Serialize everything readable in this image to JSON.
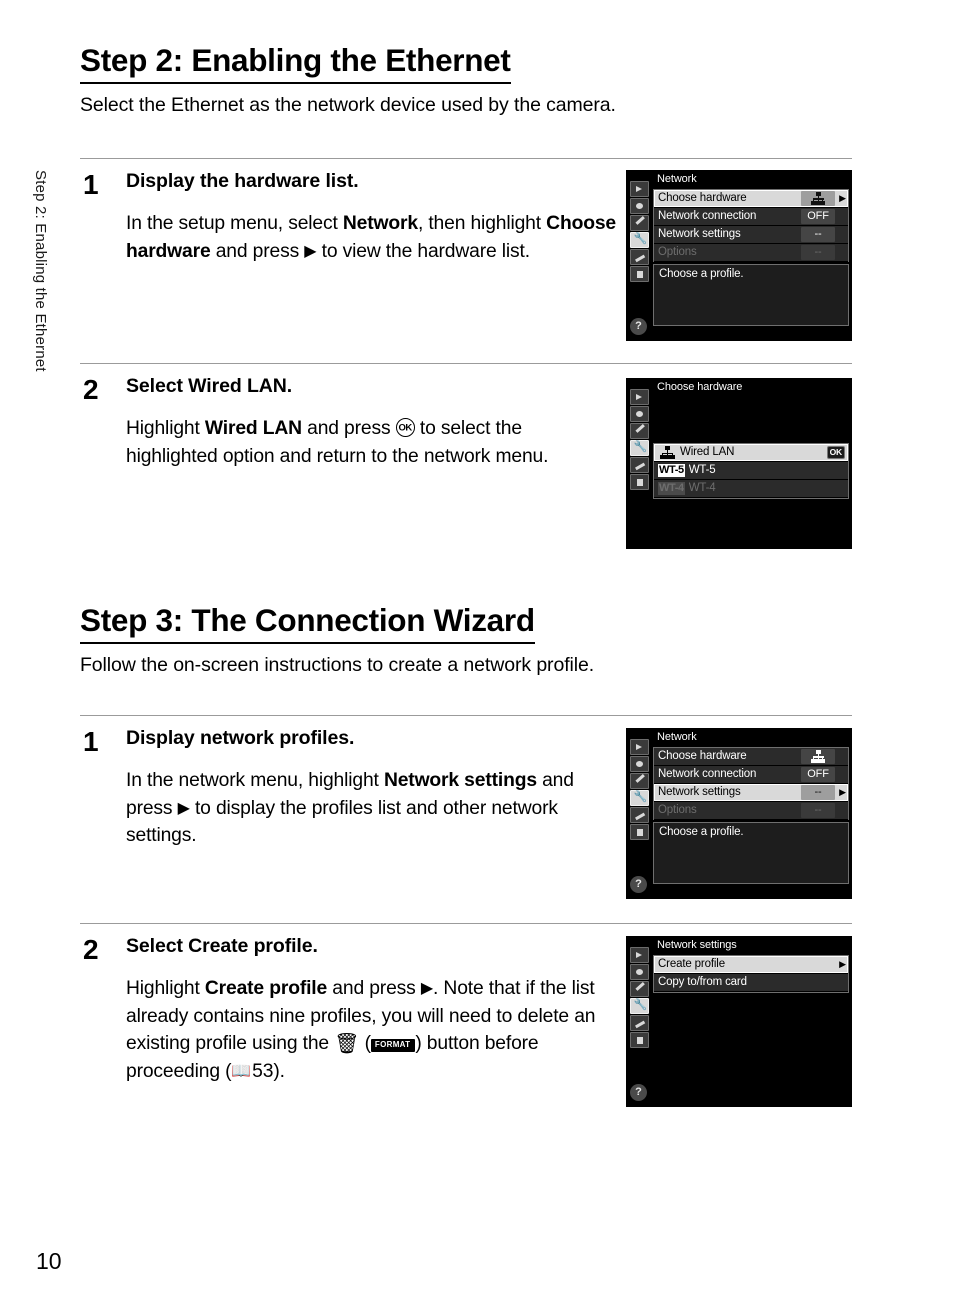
{
  "page_number": "10",
  "side_tab": "Step 2: Enabling the Ethernet",
  "sections": [
    {
      "title": "Step 2: Enabling the Ethernet",
      "subtitle": "Select the Ethernet as the network device used by the camera."
    },
    {
      "title": "Step 3: The Connection Wizard",
      "subtitle": "Follow the on-screen instructions to create a network profile."
    }
  ],
  "steps": {
    "s2_1": {
      "number": "1",
      "heading": "Display the hardware list.",
      "text_1": "In the setup menu, select ",
      "bold_1": "Network",
      "text_2": ", then highlight ",
      "bold_2": "Choose hardware",
      "text_3": " and press ",
      "glyph": "▶",
      "text_4": " to view the hardware list."
    },
    "s2_2": {
      "number": "2",
      "heading_plain": "Select ",
      "heading_bold": "Wired LAN",
      "heading_end": ".",
      "text_1": "Highlight ",
      "bold_1": "Wired LAN",
      "text_2": " and press ",
      "ok_glyph": "OK",
      "text_3": " to select the highlighted option and return to the network menu."
    },
    "s3_1": {
      "number": "1",
      "heading": "Display network profiles.",
      "text_1": "In the network menu, highlight ",
      "bold_1": "Network settings",
      "text_2": " and press ",
      "glyph": "▶",
      "text_3": " to display the profiles list and other network settings."
    },
    "s3_2": {
      "number": "2",
      "heading_plain": "Select ",
      "heading_bold": "Create profile",
      "heading_end": ".",
      "text_1": "Highlight ",
      "bold_1": "Create profile",
      "text_2": " and press ",
      "glyph": "▶",
      "text_3": ". Note that if the list already contains nine profiles, you will need to delete an existing profile using the ",
      "trash_glyph": "🗑",
      "text_4": " (",
      "format_label": "FORMAT",
      "text_5": ") button before proceeding (",
      "book_glyph": "📖",
      "page_ref": "53",
      "text_6": ")."
    }
  },
  "lcd_screens": {
    "network_1": {
      "title": "Network",
      "rows": [
        {
          "label": "Choose hardware",
          "value": "",
          "icon": "network-icon",
          "arrow": true,
          "highlighted": true,
          "dimmed": false
        },
        {
          "label": "Network connection",
          "value": "OFF",
          "icon": "",
          "arrow": false,
          "highlighted": false,
          "dimmed": false
        },
        {
          "label": "Network settings",
          "value": "--",
          "icon": "",
          "arrow": false,
          "highlighted": false,
          "dimmed": false
        },
        {
          "label": "Options",
          "value": "--",
          "icon": "",
          "arrow": false,
          "highlighted": false,
          "dimmed": true
        }
      ],
      "description": "Choose a profile."
    },
    "choose_hardware": {
      "title": "Choose hardware",
      "rows": [
        {
          "label": "Wired LAN",
          "tag": "",
          "icon": "network-icon",
          "badge": "OK",
          "highlighted": true,
          "dimmed": false
        },
        {
          "label": "WT-5",
          "tag": "WT-5",
          "icon": "",
          "badge": "",
          "highlighted": false,
          "dimmed": false
        },
        {
          "label": "WT-4",
          "tag": "WT-4",
          "icon": "",
          "badge": "",
          "highlighted": false,
          "dimmed": true
        }
      ]
    },
    "network_2": {
      "title": "Network",
      "rows": [
        {
          "label": "Choose hardware",
          "value": "",
          "icon": "network-icon",
          "arrow": false,
          "highlighted": false,
          "dimmed": false
        },
        {
          "label": "Network connection",
          "value": "OFF",
          "icon": "",
          "arrow": false,
          "highlighted": false,
          "dimmed": false
        },
        {
          "label": "Network settings",
          "value": "--",
          "icon": "",
          "arrow": true,
          "highlighted": true,
          "dimmed": false
        },
        {
          "label": "Options",
          "value": "--",
          "icon": "",
          "arrow": false,
          "highlighted": false,
          "dimmed": true
        }
      ],
      "description": "Choose a profile."
    },
    "network_settings": {
      "title": "Network settings",
      "rows": [
        {
          "label": "Create profile",
          "value": "",
          "icon": "",
          "arrow": true,
          "highlighted": true,
          "dimmed": false
        },
        {
          "label": "Copy to/from card",
          "value": "",
          "icon": "",
          "arrow": false,
          "highlighted": false,
          "dimmed": false
        }
      ]
    }
  },
  "rail_icons": [
    "playback-icon",
    "shooting-menu-icon",
    "custom-settings-icon",
    "setup-menu-icon",
    "retouch-icon",
    "my-menu-icon"
  ],
  "rail_help": "?"
}
